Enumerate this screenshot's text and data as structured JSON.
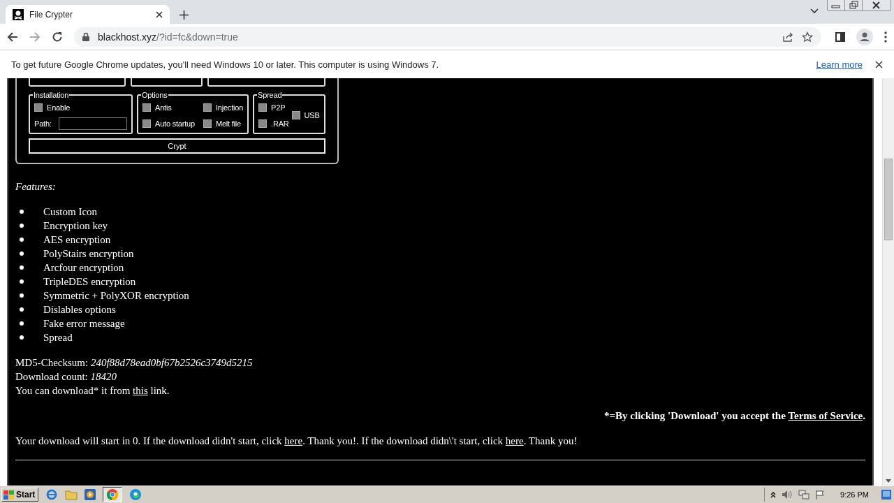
{
  "browser": {
    "tab": {
      "title": "File Crypter",
      "selected": true
    },
    "url": {
      "host": "blackhost.xyz",
      "path": "/?id=fc&down=true"
    }
  },
  "infobar": {
    "message": "To get future Google Chrome updates, you'll need Windows 10 or later. This computer is using Windows 7.",
    "link": "Learn more"
  },
  "crypter": {
    "groups": [
      {
        "title": "Installation",
        "kind": "install",
        "items": [
          {
            "label": "Enable",
            "checked": false
          }
        ],
        "field_label": "Path:"
      },
      {
        "title": "Options",
        "kind": "grid",
        "items": [
          {
            "label": "Antis",
            "checked": false
          },
          {
            "label": "Injection",
            "checked": false
          },
          {
            "label": "Auto startup",
            "checked": false
          },
          {
            "label": "Melt file",
            "checked": false
          }
        ]
      },
      {
        "title": "Spread",
        "kind": "spread",
        "items": [
          {
            "label": "P2P",
            "checked": false
          },
          {
            "label": ".RAR",
            "checked": false
          },
          {
            "label": "USB",
            "checked": false
          }
        ]
      }
    ],
    "button": "Crypt"
  },
  "features": {
    "heading": "Features:",
    "items": [
      "Custom Icon",
      "Encryption key",
      "AES encryption",
      "PolyStairs encryption",
      "Arcfour encryption",
      "TripleDES encryption",
      "Symmetric + PolyXOR encryption",
      "Dislables options",
      "Fake error message",
      "Spread"
    ]
  },
  "md5": "MD5-Checksum: *240f88d78ead0bf67b2526c3749d5215*",
  "count": "Download count: *18420*",
  "download": {
    "before": "You can download* it from ",
    "link": "this",
    "after": " link."
  },
  "terms": {
    "before": "*=By clicking 'Download' you accept the ",
    "link": "Terms of Service",
    "after": "."
  },
  "notice": [
    {
      "kind": "text",
      "text": "Your download will start in 0. If the download didn't start, click "
    },
    {
      "kind": "link",
      "text": "here"
    },
    {
      "kind": "text",
      "text": ". Thank you!. If the download didn\\'t start, click "
    },
    {
      "kind": "link",
      "text": "here"
    },
    {
      "kind": "text",
      "text": ". Thank you!"
    }
  ],
  "taskbar": {
    "start": "Start",
    "clock": "9:26 PM"
  }
}
